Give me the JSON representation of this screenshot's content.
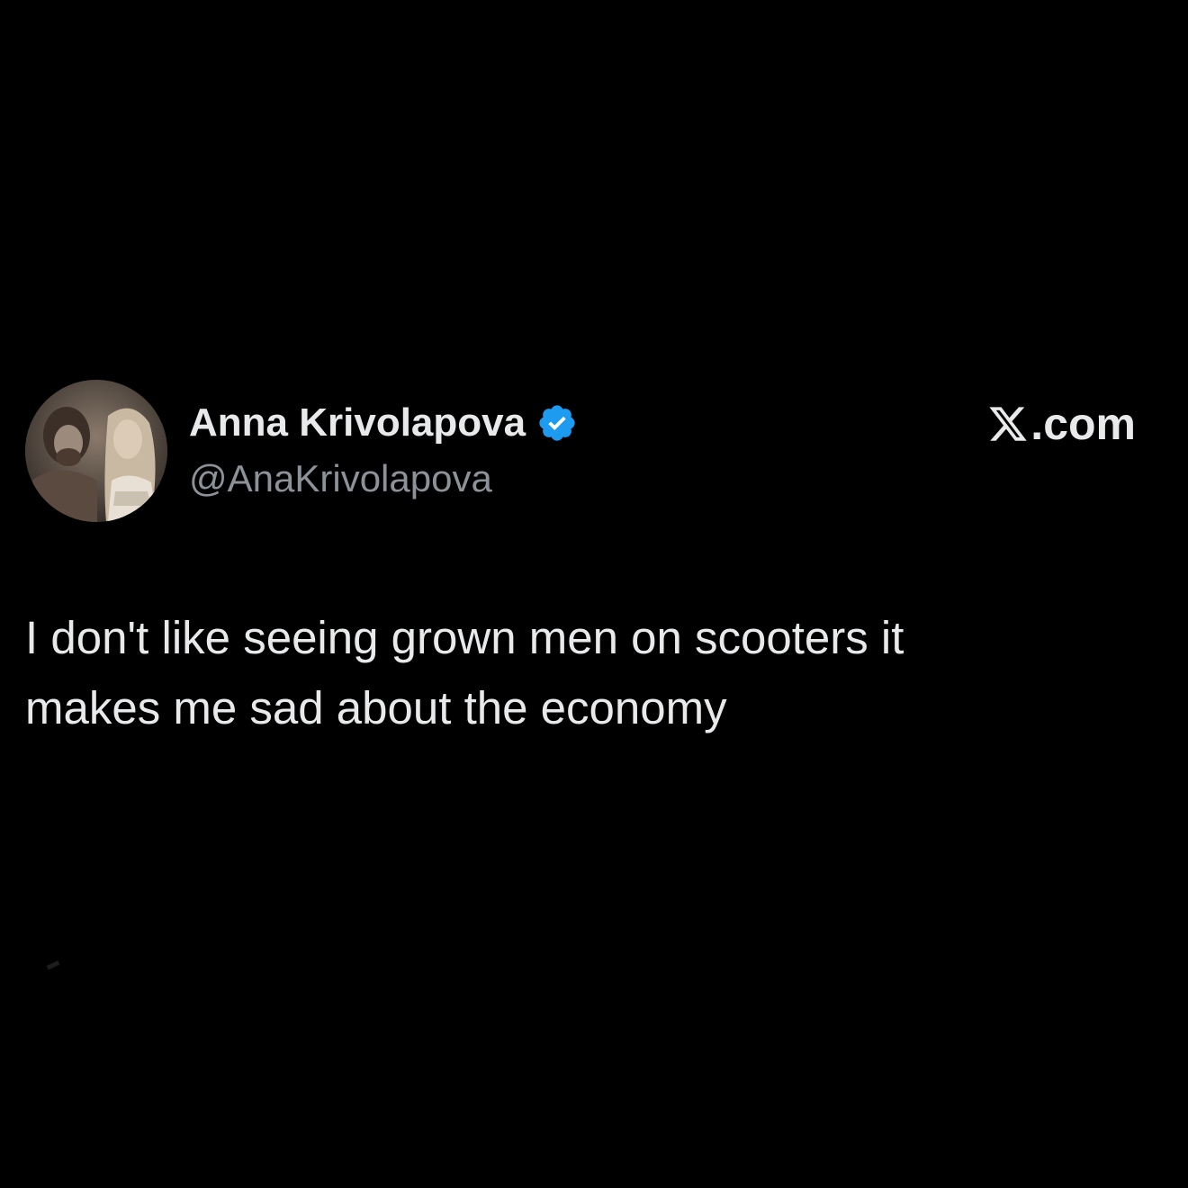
{
  "author": {
    "display_name": "Anna Krivolapova",
    "handle": "@AnaKrivolapova",
    "verified": true,
    "avatar_icon": "avatar-photo-icon",
    "verified_icon": "verified-badge-icon",
    "verified_color": "#1d9bf0"
  },
  "brand": {
    "suffix": ".com",
    "logo_icon": "x-logo-icon"
  },
  "tweet": {
    "lines": [
      "I don't like seeing grown men on scooters it",
      "makes me sad about the economy"
    ]
  },
  "colors": {
    "background": "#000000",
    "text_primary": "#e7e9ea",
    "text_secondary": "#8b9298"
  }
}
